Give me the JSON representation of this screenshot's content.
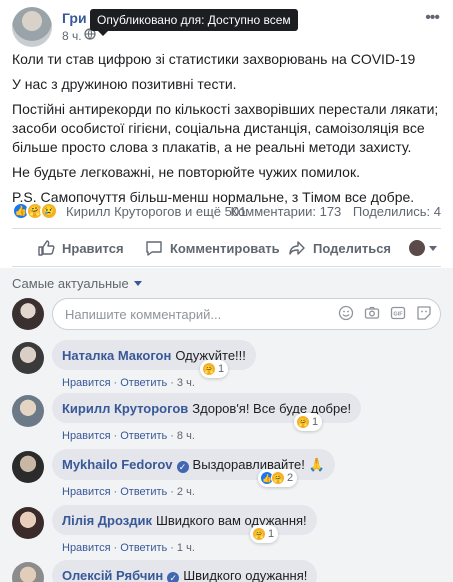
{
  "post": {
    "author": "Гри",
    "time": "8 ч.",
    "tooltip": "Опубликовано для: Доступно всем",
    "paragraphs": [
      "Коли ти став цифрою зі статистики захворювань на COVID-19",
      "У нас з дружиною позитивні тести.",
      "Постійні антирекорди по кількості захворівших перестали лякати; засоби особистої гігієни, соціальна дистанція, самоізоляція все більше просто слова з плакатів, а не реальні методи захисту.",
      "Не будьте легковажні, не повторюйте чужих помилок.",
      "P.S. Самопочуття більш-менш нормальне, з Тімом все добре."
    ],
    "reactions_names": "Кирилл Круторогов и ещё 501",
    "comments_count": "Комментарии: 173",
    "shares_count": "Поделились: 4"
  },
  "actions": {
    "like": "Нравится",
    "comment": "Комментировать",
    "share": "Поделиться"
  },
  "comments_section": {
    "sort_label": "Самые актуальные",
    "composer_placeholder": "Напишите комментарий...",
    "like_label": "Нравится",
    "reply_label": "Ответить",
    "comments": [
      {
        "author": "Наталка Макогон",
        "verified": false,
        "text": "Одужуйте!!!",
        "time": "3 ч.",
        "reactions": "1"
      },
      {
        "author": "Кирилл Круторогов",
        "verified": false,
        "text": "Здоров'я! Все буде добре!",
        "time": "8 ч.",
        "reactions": "1"
      },
      {
        "author": "Mykhailo Fedorov",
        "verified": true,
        "text": "Выздоравливайте! 🙏",
        "time": "2 ч.",
        "reactions": "2"
      },
      {
        "author": "Лілія Дроздик",
        "verified": false,
        "text": "Швидкого вам одужання!",
        "time": "1 ч.",
        "reactions": "1"
      },
      {
        "author": "Олексій Рябчин",
        "verified": true,
        "text": "Швидкого одужання!",
        "time": "",
        "reactions": ""
      }
    ]
  },
  "colors": {
    "link": "#385898",
    "muted": "#606770",
    "bubble": "#e4e6eb",
    "comments_bg": "#f2f3f5"
  }
}
